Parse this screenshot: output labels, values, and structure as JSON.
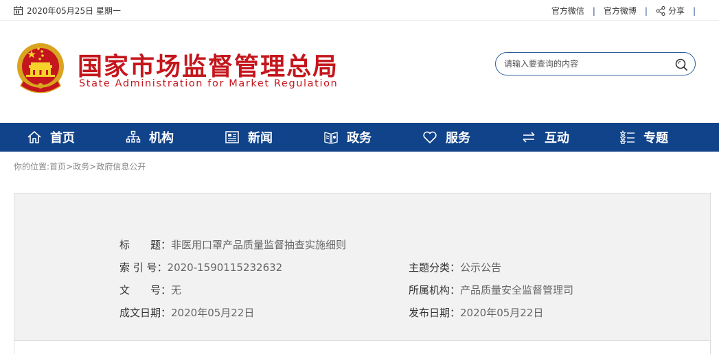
{
  "topbar": {
    "date": "2020年05月25日 星期一",
    "links": [
      "官方微信",
      "官方微博"
    ],
    "share": "分享"
  },
  "header": {
    "title": "国家市场监督管理总局",
    "subtitle": "State Administration for Market Regulation",
    "search_placeholder": "请输入要查询的内容"
  },
  "nav": {
    "items": [
      {
        "label": "首页",
        "icon": "home-icon"
      },
      {
        "label": "机构",
        "icon": "org-icon"
      },
      {
        "label": "新闻",
        "icon": "news-icon"
      },
      {
        "label": "政务",
        "icon": "affairs-icon"
      },
      {
        "label": "服务",
        "icon": "heart-icon"
      },
      {
        "label": "互动",
        "icon": "exchange-icon"
      },
      {
        "label": "专题",
        "icon": "topics-icon"
      }
    ]
  },
  "breadcrumb": {
    "prefix": "你的位置:",
    "items": [
      "首页",
      "政务",
      "政府信息公开"
    ],
    "sep": ">"
  },
  "doc": {
    "title_label": "标　　题：",
    "title_value": "非医用口罩产品质量监督抽查实施细则",
    "index_label": "索 引 号：",
    "index_value": "2020-1590115232632",
    "category_label": "主题分类：",
    "category_value": "公示公告",
    "docno_label": "文　　号：",
    "docno_value": "无",
    "org_label": "所属机构：",
    "org_value": "产品质量安全监督管理司",
    "written_label": "成文日期：",
    "written_value": "2020年05月22日",
    "published_label": "发布日期：",
    "published_value": "2020年05月22日"
  },
  "colors": {
    "nav_bg": "#10438a",
    "title_red": "#c4161c"
  }
}
